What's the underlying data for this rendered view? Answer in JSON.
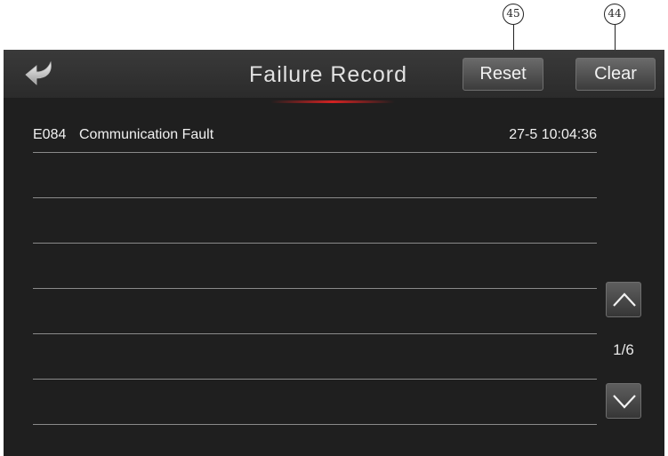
{
  "callouts": [
    {
      "number": "45",
      "target": "Reset"
    },
    {
      "number": "44",
      "target": "Clear"
    }
  ],
  "header": {
    "title": "Failure Record",
    "reset_label": "Reset",
    "clear_label": "Clear",
    "back_icon": "back-arrow-icon",
    "accent_color": "#d32222"
  },
  "records": [
    {
      "code": "E084",
      "description": "Communication Fault",
      "time": "27-5 10:04:36"
    },
    {
      "code": "",
      "description": "",
      "time": ""
    },
    {
      "code": "",
      "description": "",
      "time": ""
    },
    {
      "code": "",
      "description": "",
      "time": ""
    },
    {
      "code": "",
      "description": "",
      "time": ""
    },
    {
      "code": "",
      "description": "",
      "time": ""
    },
    {
      "code": "",
      "description": "",
      "time": ""
    }
  ],
  "pager": {
    "page_label": "1/6",
    "up_icon": "chevron-up-icon",
    "down_icon": "chevron-down-icon"
  }
}
